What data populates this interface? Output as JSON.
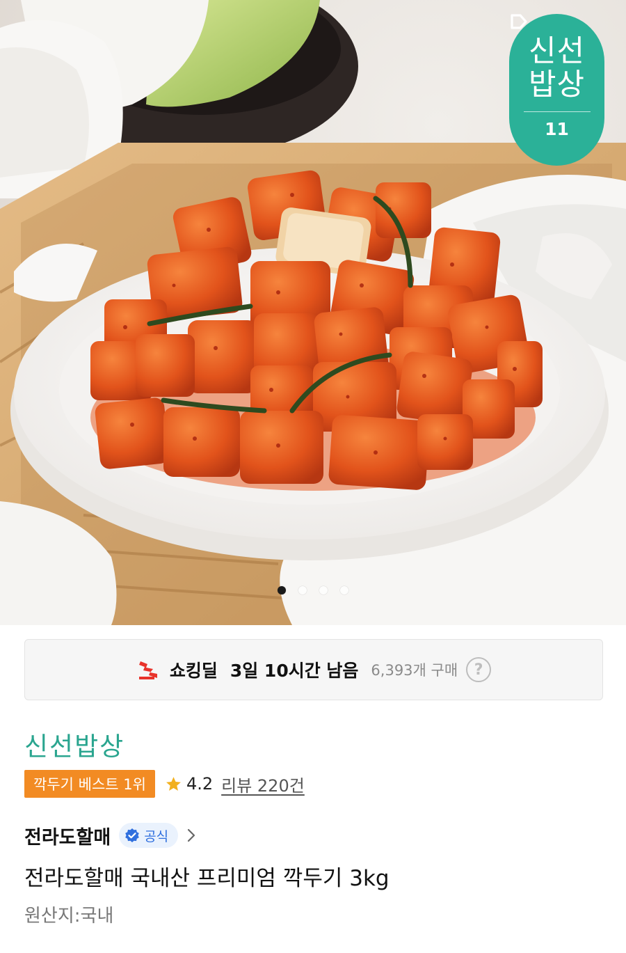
{
  "hero": {
    "image_alt": "kkakdugi-product-photo",
    "brand_badge": {
      "line1": "신선",
      "line2": "밥상",
      "mark": "11"
    },
    "carousel": {
      "total": 4,
      "active": 0
    }
  },
  "deal": {
    "icon": "shocking-deal-icon",
    "name": "쇼킹딜",
    "remaining": "3일 10시간 남음",
    "purchase_count": "6,393개 구매",
    "help": "?"
  },
  "product": {
    "store": "신선밥상",
    "rank_badge": "깍두기 베스트 1위",
    "rating": "4.2",
    "reviews": "리뷰 220건",
    "seller": "전라도할매",
    "official": "공식",
    "title": "전라도할매 국내산 프리미엄 깍두기 3kg",
    "origin": "원산지:국내"
  },
  "colors": {
    "brand_green": "#2bb198",
    "store_text": "#2aa58f",
    "rank_orange": "#f28b23",
    "star": "#f2b01e",
    "official_blue": "#2f6fde",
    "deal_red": "#e8332b"
  }
}
